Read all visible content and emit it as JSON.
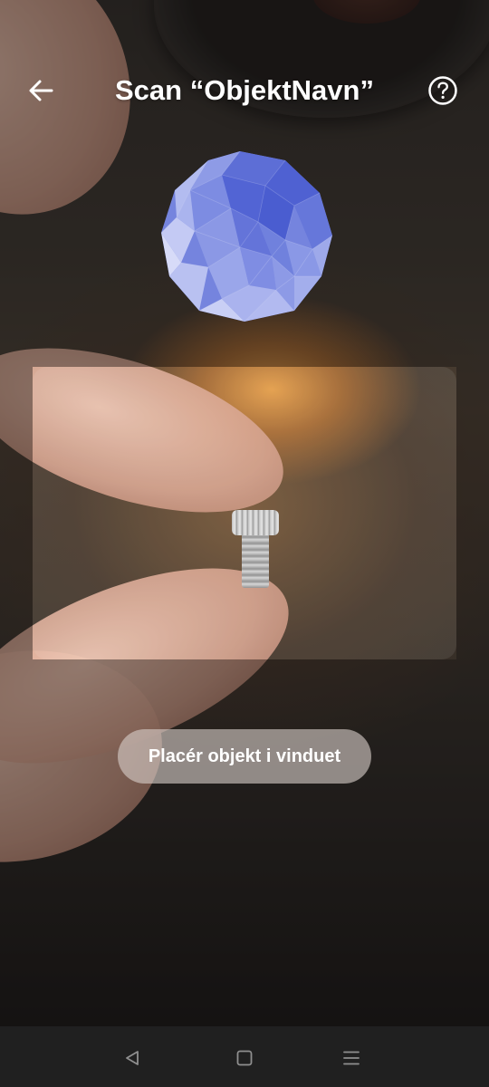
{
  "header": {
    "title": "Scan “ObjektNavn”",
    "back_icon": "arrow-left-icon",
    "help_icon": "question-circle-icon"
  },
  "scan": {
    "orb_icon": "geodesic-sphere-icon",
    "hint": "Placér objekt i vinduet"
  },
  "nav": {
    "back_icon": "nav-back-icon",
    "home_icon": "nav-home-icon",
    "recents_icon": "nav-recents-icon"
  },
  "colors": {
    "orb": "#6f7fe0",
    "nav_bar": "#202020",
    "pill": "#d7cdc8"
  }
}
